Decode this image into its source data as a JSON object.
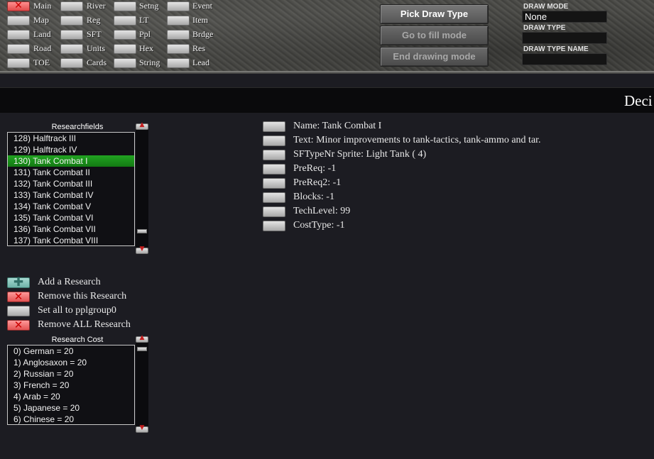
{
  "toolbar": {
    "buttons": [
      {
        "label": "Main"
      },
      {
        "label": "Map"
      },
      {
        "label": "Land"
      },
      {
        "label": "Road"
      },
      {
        "label": "TOE"
      },
      {
        "label": "River"
      },
      {
        "label": "Reg"
      },
      {
        "label": "SFT"
      },
      {
        "label": "Units"
      },
      {
        "label": "Cards"
      },
      {
        "label": "Setng"
      },
      {
        "label": "LT"
      },
      {
        "label": "Ppl"
      },
      {
        "label": "Hex"
      },
      {
        "label": "String"
      },
      {
        "label": "Event"
      },
      {
        "label": "Item"
      },
      {
        "label": "Brdge"
      },
      {
        "label": "Res"
      },
      {
        "label": "Lead"
      }
    ],
    "close_glyph": "✕",
    "pick_draw_type": "Pick Draw Type",
    "go_fill_mode": "Go to fill mode",
    "end_drawing_mode": "End drawing mode",
    "draw_mode_label": "DRAW MODE",
    "draw_mode_value": "None",
    "draw_type_label": "DRAW TYPE",
    "draw_type_value": "",
    "draw_type_name_label": "DRAW TYPE NAME",
    "draw_type_name_value": ""
  },
  "header": {
    "title": "Deci"
  },
  "researchfields": {
    "label": "Researchfields",
    "items": [
      "128) Halftrack III",
      "129) Halftrack IV",
      "130) Tank Combat I",
      "131) Tank Combat II",
      "132) Tank Combat III",
      "133) Tank Combat IV",
      "134) Tank Combat V",
      "135) Tank Combat VI",
      "136) Tank Combat VII",
      "137) Tank Combat VIII"
    ],
    "selected_index": 2
  },
  "properties": [
    "Name: Tank Combat I",
    "Text: Minor improvements to tank-tactics, tank-ammo and tar.",
    "SFTypeNr Sprite: Light Tank ( 4)",
    "PreReq: -1",
    "PreReq2: -1",
    "Blocks: -1",
    "TechLevel:  99",
    "CostType: -1"
  ],
  "actions": {
    "add": "Add a Research",
    "remove": "Remove this Research",
    "set_all": "Set all to pplgroup0",
    "remove_all": "Remove ALL Research",
    "plus_glyph": "✚",
    "x_glyph": "✕"
  },
  "research_cost": {
    "label": "Research Cost",
    "items": [
      "0) German =  20",
      "1) Anglosaxon =  20",
      "2) Russian =  20",
      "3) French =  20",
      "4) Arab =  20",
      "5) Japanese =  20",
      "6) Chinese =  20"
    ]
  },
  "scroll": {
    "up_glyph": "▲",
    "down_glyph": "▼"
  },
  "colors": {
    "selected_row": "#1a8f1a",
    "active_button": "#e25252",
    "background": "#1c1c22"
  }
}
